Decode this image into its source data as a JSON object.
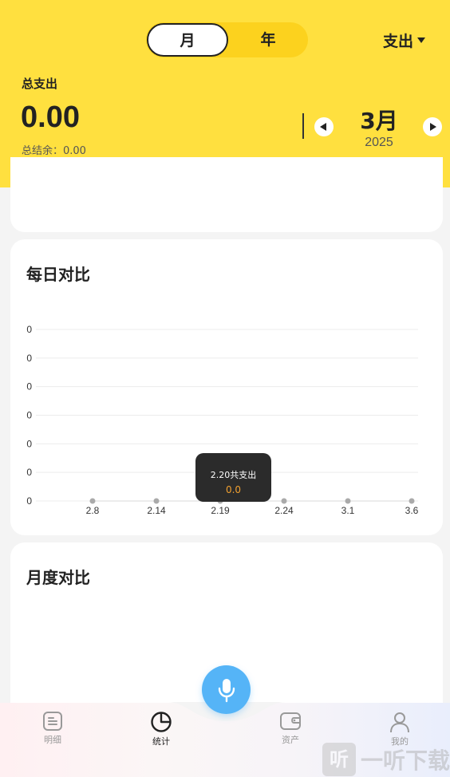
{
  "header": {
    "period_toggle": {
      "month_label": "月",
      "year_label": "年",
      "selected": "month"
    },
    "type_select": "支出",
    "total_label": "总支出",
    "total_amount": "0.00",
    "balance": "总结余：0.00",
    "period": {
      "month": "3月",
      "year": "2025"
    }
  },
  "daily_card": {
    "title": "每日对比"
  },
  "monthly_card": {
    "title": "月度对比"
  },
  "chart_data": {
    "type": "line",
    "x": [
      "2.8",
      "2.14",
      "2.19",
      "2.24",
      "3.1",
      "3.6"
    ],
    "series": [
      {
        "values": [
          0,
          0,
          0,
          0,
          0,
          0
        ]
      }
    ],
    "y_ticks": [
      "0",
      "0",
      "0",
      "0",
      "0",
      "0",
      "0"
    ],
    "grid": true,
    "tooltip": {
      "label": "2.20共支出",
      "value": "0.0"
    }
  },
  "tabbar": {
    "items": [
      {
        "label": "明细",
        "icon": "list-icon",
        "active": false
      },
      {
        "label": "统计",
        "icon": "pie-chart-icon",
        "active": true
      },
      {
        "label": "资产",
        "icon": "wallet-icon",
        "active": false
      },
      {
        "label": "我的",
        "icon": "user-icon",
        "active": false
      }
    ],
    "voice_button": "microphone-icon"
  },
  "watermark": {
    "logo": "听",
    "text": "一听下载"
  },
  "colors": {
    "accent": "#ffe03f",
    "toggle": "#fcd21e",
    "mic": "#55b4f7",
    "tooltip_value": "#f0a030"
  }
}
